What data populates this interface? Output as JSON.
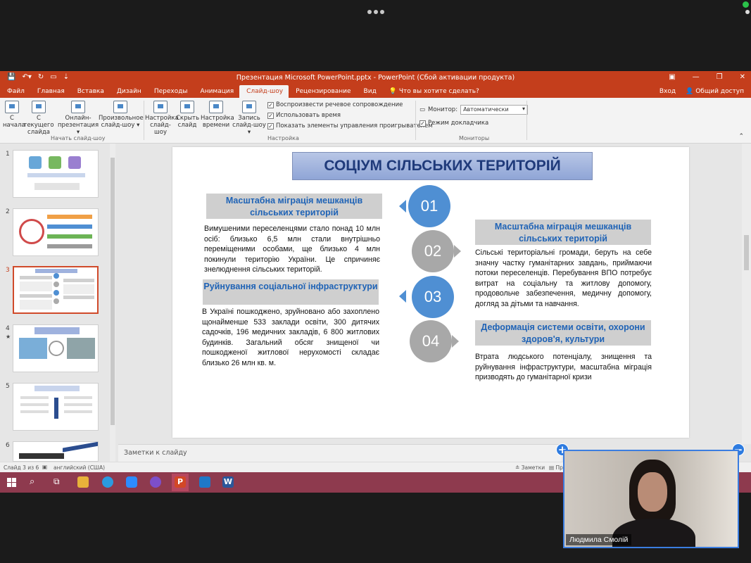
{
  "ppt": {
    "window_title": "Презентация Microsoft PowerPoint.pptx - PowerPoint (Сбой активации продукта)",
    "tabs": [
      "Файл",
      "Главная",
      "Вставка",
      "Дизайн",
      "Переходы",
      "Анимация",
      "Слайд-шоу",
      "Рецензирование",
      "Вид"
    ],
    "tell_me": "Что вы хотите сделать?",
    "signin": "Вход",
    "share": "Общий доступ"
  },
  "ribbon": {
    "from_start": [
      "С",
      "начала"
    ],
    "from_current": [
      "С текущего",
      "слайда"
    ],
    "online": [
      "Онлайн-",
      "презентация ▾"
    ],
    "custom": [
      "Произвольное",
      "слайд-шоу ▾"
    ],
    "setup": [
      "Настройка",
      "слайд-шоу"
    ],
    "hide": [
      "Скрыть",
      "слайд"
    ],
    "rehearse": [
      "Настройка",
      "времени"
    ],
    "record": [
      "Запись",
      "слайд-шоу ▾"
    ],
    "group_start": "Начать слайд-шоу",
    "group_setup": "Настройка",
    "group_monitors": "Мониторы",
    "chk1": "Воспроизвести речевое сопровождение",
    "chk2": "Использовать время",
    "chk3": "Показать элементы управления проигрывателем",
    "monitor_label": "Монитор:",
    "monitor_value": "Автоматически",
    "presenter_view": "Режим докладчика"
  },
  "thumb_numbers": [
    "1",
    "2",
    "3",
    "4",
    "5",
    "6"
  ],
  "slide": {
    "title": "СОЦІУМ СІЛЬСЬКИХ ТЕРИТОРІЙ",
    "h1": "Масштабна міграція мешканців сільських територій",
    "b1": "Вимушеними переселенцями стало понад 10 млн осіб: близько 6,5 млн стали внутрішньо переміщеними особами, ще близько 4 млн покинули територію України. Це спричиняє знелюднення сільських територій.",
    "h2": "Руйнування соціальної інфраструктури",
    "b2": "В Україні пошкоджено, зруйновано або захоплено щонайменше 533 заклади освіти, 300 дитячих садочків, 196 медичних закладів, 6 800 житлових будинків. Загальний обсяг знищеної чи пошкодженої житлової нерухомості складає близько 26 млн кв. м.",
    "h3": "Масштабна міграція мешканців сільських територій",
    "b3": "Сільські територіальні громади, беруть на себе значну частку гуманітарних завдань, приймаючи потоки переселенців. Перебування ВПО потребує витрат на соціальну та житлову допомогу, продовольче забезпечення, медичну допомогу, догляд за дітьми та навчання.",
    "h4": "Деформація системи освіти, охорони здоров'я, культури",
    "b4": "Втрата людського потенціалу, знищення та руйнування інфраструктури, масштабна міграція призводять до гуманітарної кризи",
    "c1": "01",
    "c2": "02",
    "c3": "03",
    "c4": "04"
  },
  "notes_placeholder": "Заметки к слайду",
  "status": {
    "slide_of": "Слайд 3 из 6",
    "language": "английский (США)",
    "notes_btn": "Заметки",
    "pr": "Пр"
  },
  "video": {
    "name": "Людмила Смолій"
  },
  "colors": {
    "ppt_accent": "#c43e1c",
    "taskbar": "#8e3a4e",
    "circle_blue": "#4f8fd3",
    "zoom_blue": "#2d7be0"
  }
}
